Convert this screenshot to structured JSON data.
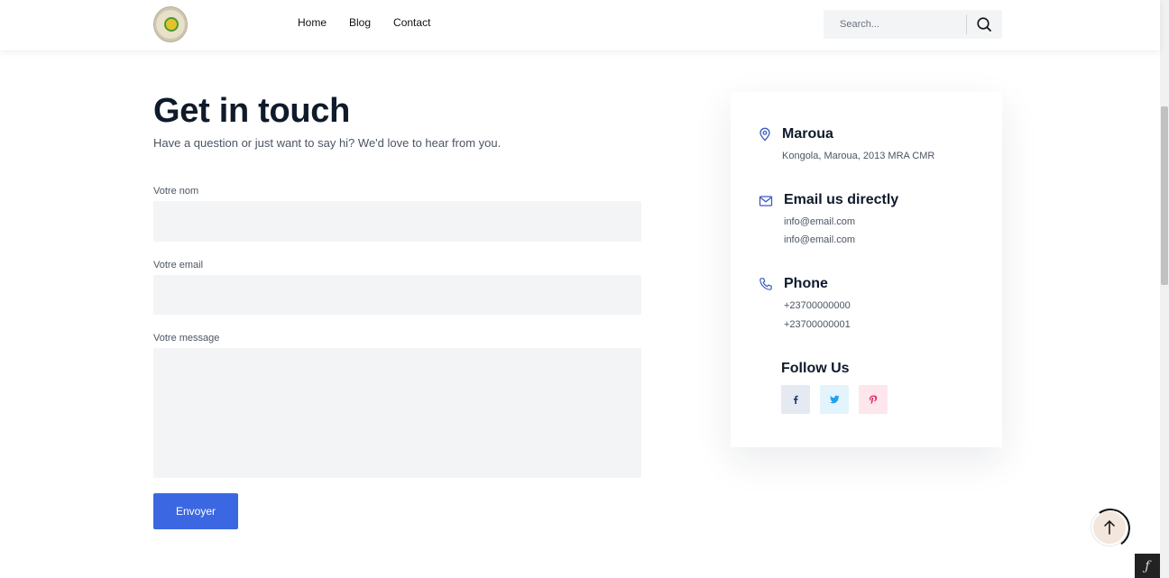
{
  "header": {
    "logo_name": "university-seal",
    "nav": [
      "Home",
      "Blog",
      "Contact"
    ],
    "search_placeholder": "Search..."
  },
  "main": {
    "title": "Get in touch",
    "subtitle": "Have a question or just want to say hi? We'd love to hear from you.",
    "form": {
      "name_label": "Votre nom",
      "name_value": "",
      "email_label": "Votre email",
      "email_value": "",
      "message_label": "Votre message",
      "message_value": "",
      "submit_label": "Envoyer"
    }
  },
  "contact_card": {
    "location_title": "Maroua",
    "location_address": "Kongola, Maroua, 2013 MRA CMR",
    "email_title": "Email us directly",
    "emails": [
      "info@email.com",
      "info@email.com"
    ],
    "phone_title": "Phone",
    "phones": [
      "+23700000000",
      "+23700000001"
    ],
    "follow_title": "Follow Us",
    "socials": [
      {
        "icon": "facebook-icon",
        "color": "#1e3a6e",
        "bg": "#e5e9f2"
      },
      {
        "icon": "twitter-icon",
        "color": "#1da1f2",
        "bg": "#e3f4fd"
      },
      {
        "icon": "pinterest-icon",
        "color": "#e0245e",
        "bg": "#fde6ec"
      }
    ]
  },
  "colors": {
    "accent": "#3b67e3",
    "icon_accent": "#3b5bbf",
    "field_bg": "#f3f4f6"
  },
  "widgets": {
    "back_to_top": "arrow-up-icon",
    "debug_toolbar": "symfony-icon"
  }
}
